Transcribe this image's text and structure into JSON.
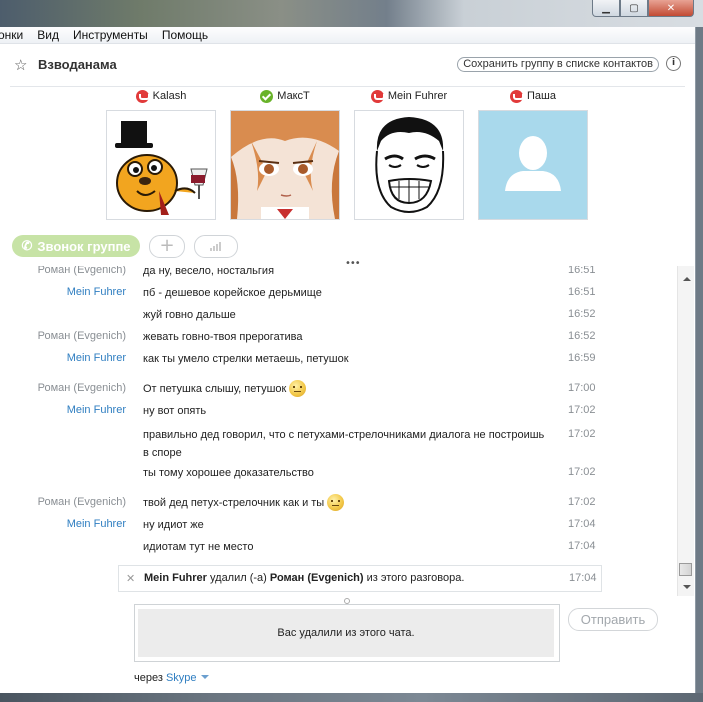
{
  "menu": [
    "онки",
    "Вид",
    "Инструменты",
    "Помощь"
  ],
  "header": {
    "title": "Взводанама",
    "save_label": "Сохранить группу в списке контактов",
    "info_label": "i"
  },
  "participants": [
    {
      "name": "Kalash",
      "status": "offline"
    },
    {
      "name": "МакcT",
      "status": "online"
    },
    {
      "name": "Mein Fuhrer",
      "status": "offline"
    },
    {
      "name": "Паша",
      "status": "offline"
    }
  ],
  "call": {
    "call_label": "Звонок группе",
    "add_label": "+",
    "more_label": "•••"
  },
  "messages": [
    {
      "sender": "Роман (Evgenich)",
      "text": "да ну, весело, ностальгия",
      "time": "16:51"
    },
    {
      "sender": "Mein Fuhrer",
      "text": "пб - дешевое корейское дерьмище",
      "time": "16:51"
    },
    {
      "sender": "",
      "text": "жуй говно дальше",
      "time": "16:52"
    },
    {
      "sender": "Роман (Evgenich)",
      "text": "жевать говно-твоя прерогатива",
      "time": "16:52"
    },
    {
      "sender": "Mein Fuhrer",
      "text": "как ты умело стрелки метаешь, петушок",
      "time": "16:59"
    },
    {
      "sender": "Роман (Evgenich)",
      "text": "От петушка слышу, петушок",
      "time": "17:00"
    },
    {
      "sender": "Mein Fuhrer",
      "text": "ну вот опять",
      "time": "17:02"
    },
    {
      "sender": "",
      "text": "правильно дед говорил, что с петухами-стрелочниками диалога не построишь в споре",
      "time": "17:02"
    },
    {
      "sender": "",
      "text": "ты тому хорошее доказательство",
      "time": "17:02"
    },
    {
      "sender": "Роман (Evgenich)",
      "text": "твой дед петух-стрелочник как и ты",
      "time": "17:02"
    },
    {
      "sender": "Mein Fuhrer",
      "text": "ну идиот же",
      "time": "17:04"
    },
    {
      "sender": "",
      "text": "идиотам тут не место",
      "time": "17:04"
    }
  ],
  "system_message": {
    "actor": "Mein Fuhrer",
    "action": " удалил (-а) ",
    "target": "Роман (Evgenich)",
    "suffix": " из этого разговора.",
    "time": "17:04"
  },
  "input": {
    "notice": "Вас удалили из этого чата.",
    "send_label": "Отправить"
  },
  "via": {
    "prefix": "через ",
    "service": "Skype"
  },
  "colors": {
    "link_blue": "#2f7ec1",
    "call_green": "#c7e3a6",
    "status_offline": "#e13a3a",
    "status_online": "#69b32a"
  }
}
